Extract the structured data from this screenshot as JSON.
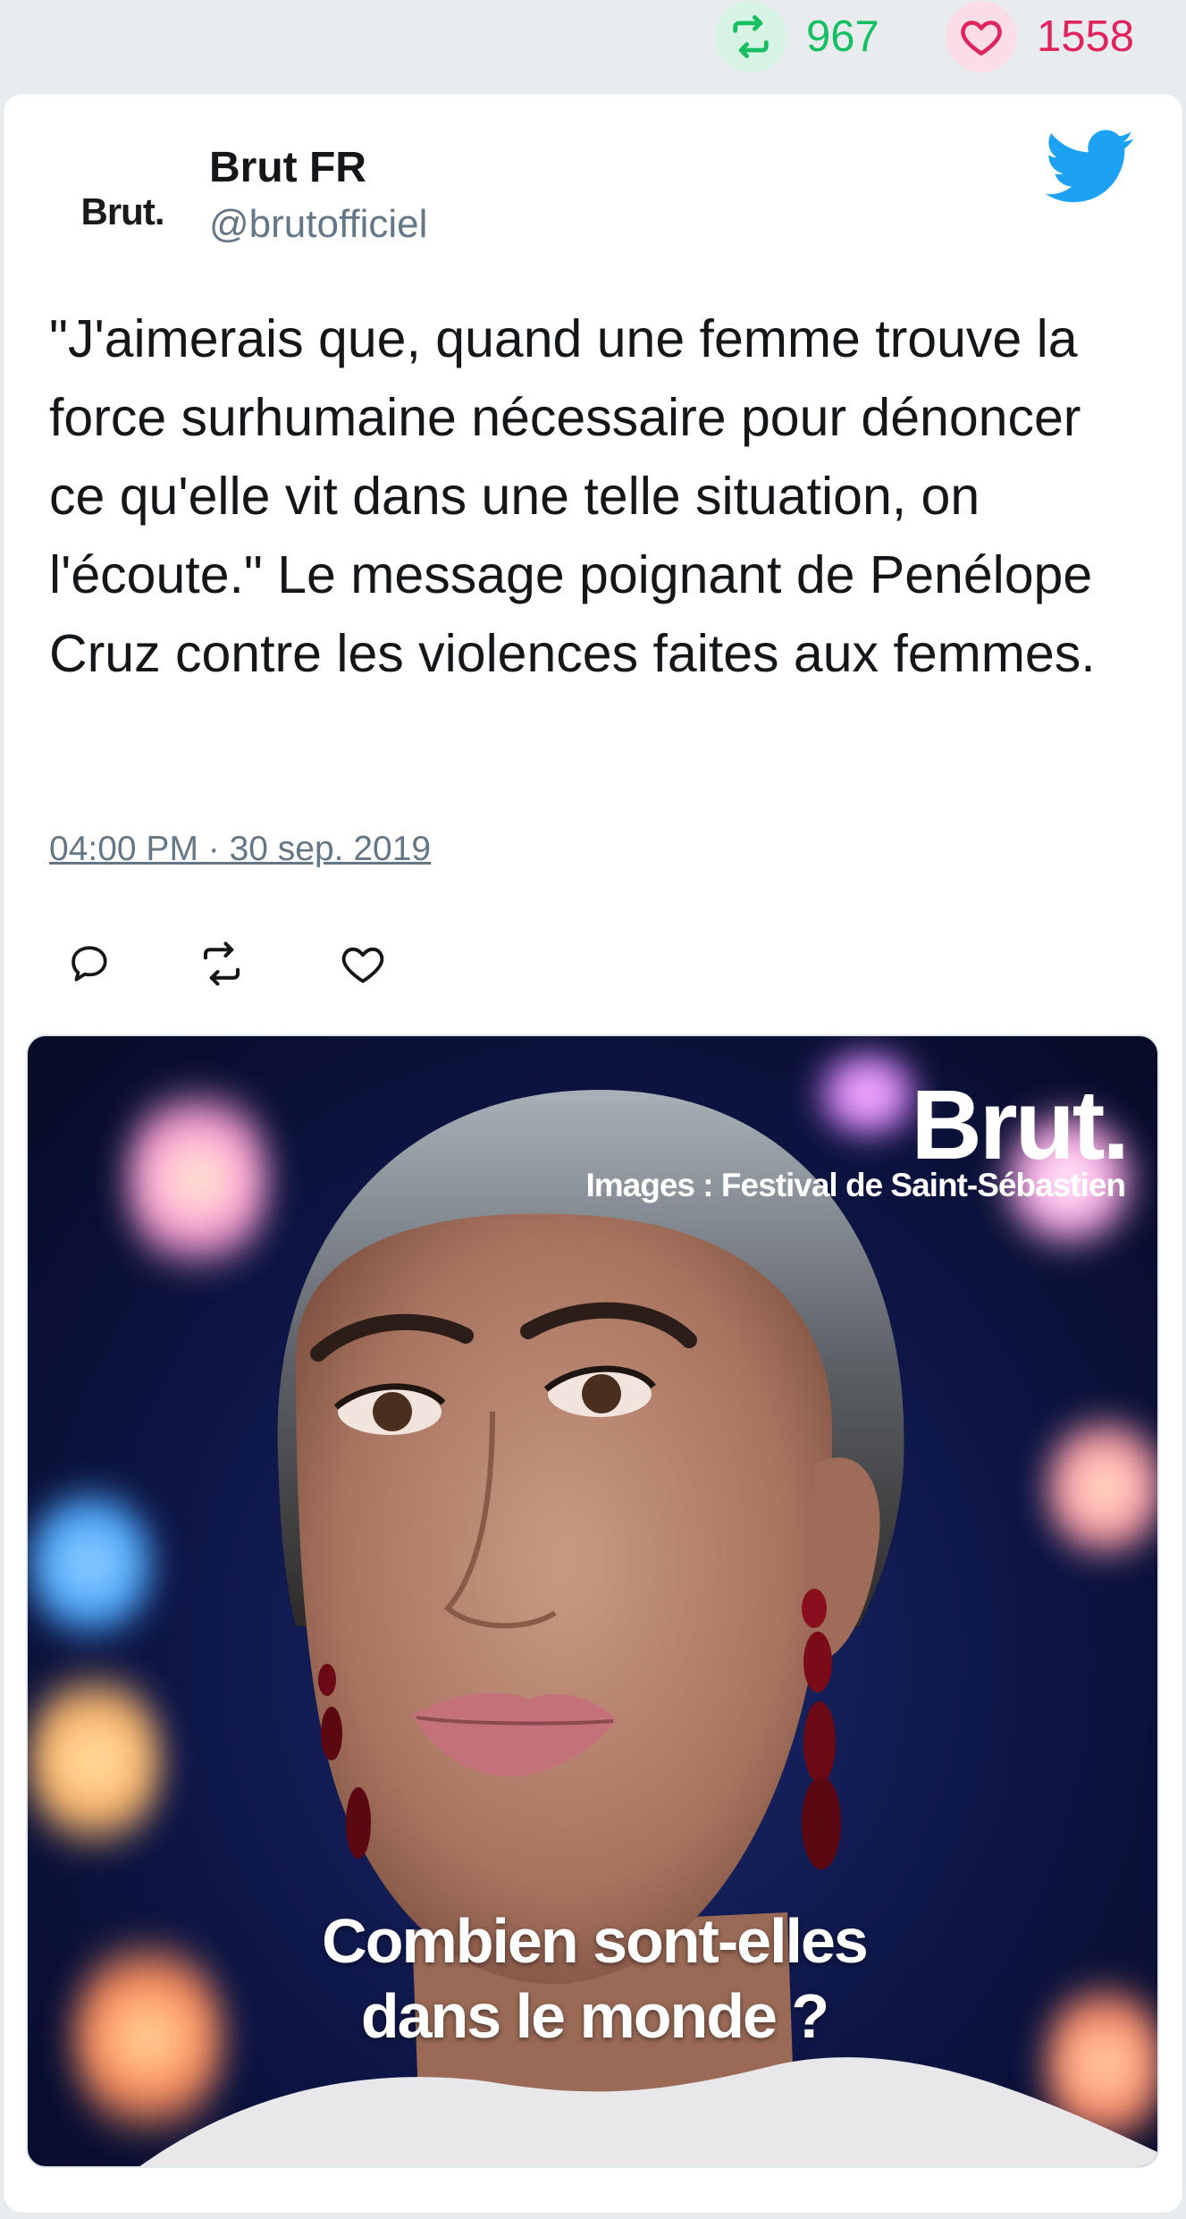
{
  "stats": {
    "retweets": "967",
    "likes": "1558",
    "retweet_color": "#17bf63",
    "like_color": "#e0245e",
    "retweet_icon": "retweet-icon",
    "like_icon": "heart-icon"
  },
  "author": {
    "avatar_text": "Brut.",
    "name": "Brut FR",
    "handle": "@brutofficiel",
    "platform_icon": "twitter-bird-icon",
    "platform_color": "#1da1f2"
  },
  "tweet": {
    "text": "\"J'aimerais que, quand une femme trouve la force surhumaine nécessaire pour dénoncer ce qu'elle vit dans une telle situation, on l'écoute.\" Le message poignant de Penélope Cruz contre les violences faites aux femmes.",
    "timestamp": "04:00 PM · 30 sep. 2019"
  },
  "actions": {
    "reply_icon": "reply-icon",
    "retweet_icon": "retweet-icon",
    "like_icon": "heart-icon"
  },
  "media": {
    "logo": "Brut.",
    "credit": "Images : Festival de Saint-Sébastien",
    "subtitle_line1": "Combien sont-elles",
    "subtitle_line2": "dans le monde ?"
  }
}
